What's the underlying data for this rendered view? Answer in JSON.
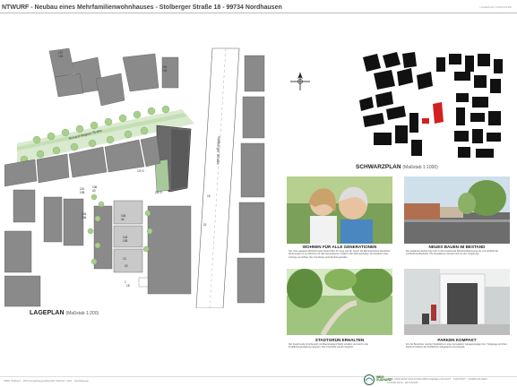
{
  "header": {
    "title_prefix": "NTWURF",
    "title_rest": " - Neubau eines Mehrfamilienwohnhauses - Stolberger Straße 18 - 99734 Nordhausen",
    "corner_note": "LAGEPLAN | ANSICHTEN"
  },
  "lageplan": {
    "label": "LAGEPLAN",
    "scale": "(Maßstab 1:200)",
    "street_vertical": "Stolberger Straße",
    "street_diagonal": "Richard-Wagner-Straße",
    "house_numbers": [
      "107",
      "109",
      "101",
      "105",
      "106",
      "108",
      "104",
      "106",
      "103",
      "105",
      "13",
      "20",
      "1",
      "18",
      "15",
      "21"
    ],
    "unit_labels": [
      "1/2 G",
      "2/4 G"
    ]
  },
  "schwarzplan": {
    "label": "SCHWARZPLAN",
    "scale": "(Maßstab 1:1000)"
  },
  "panels": [
    {
      "title": "WOHNEN FÜR ALLE GENERATIONEN",
      "text": "Der neue geplante Wohnkomplex bietet Platz für Jung und Alt. Durch die Barrierefreiheit sämtlicher Wohnungen ist ein Wohnen für alle Generationen möglich. Alle Wohneinheiten sind bequem über Aufzüge erreichbar. Die Grundrisse sind flexibel gestaltet."
    },
    {
      "title": "NEUES BAUEN IM BESTAND",
      "text": "Der geplante Neubau fügt sich in die bestehende Blockrandbebauung ein und schließt die vorhandene Baulücke. Die Gestaltung orientiert sich an der Umgebung."
    },
    {
      "title": "STADTGRÜN ERHALTEN",
      "text": "Der bestehende Grünbereich mit Baumbestand bleibt erhalten und wird in die Freiflächengestaltung integriert. Die Innenhöfe werden begrünt."
    },
    {
      "title": "PARKEN KOMPAKT",
      "text": "Für die Bewohner werden Stellplätze in einer kompakten Garagenanlage bzw. Tiefgarage errichtet. Dadurch bleiben die Freiflächen weitgehend unversiegelt."
    }
  ],
  "footer": {
    "left": "WBG Südharz - Wohnungsbaugesellschaft Südharz mbH - Nordhausen",
    "logo_text": "WBG\nSÜDHARZ",
    "right_1": "WBG SÜDHARZ WOHNUNGSBAUGESELLSCHAFT · KONTAKT · NORDHAUSEN",
    "right_2": "STAND 2019 · ENTWURF"
  },
  "colors": {
    "building": "#7a7a7a",
    "building_dark": "#555555",
    "road": "#ffffff",
    "green": "#bcd9a6",
    "tree": "#a8cf8c",
    "highlight": "#d22020"
  }
}
